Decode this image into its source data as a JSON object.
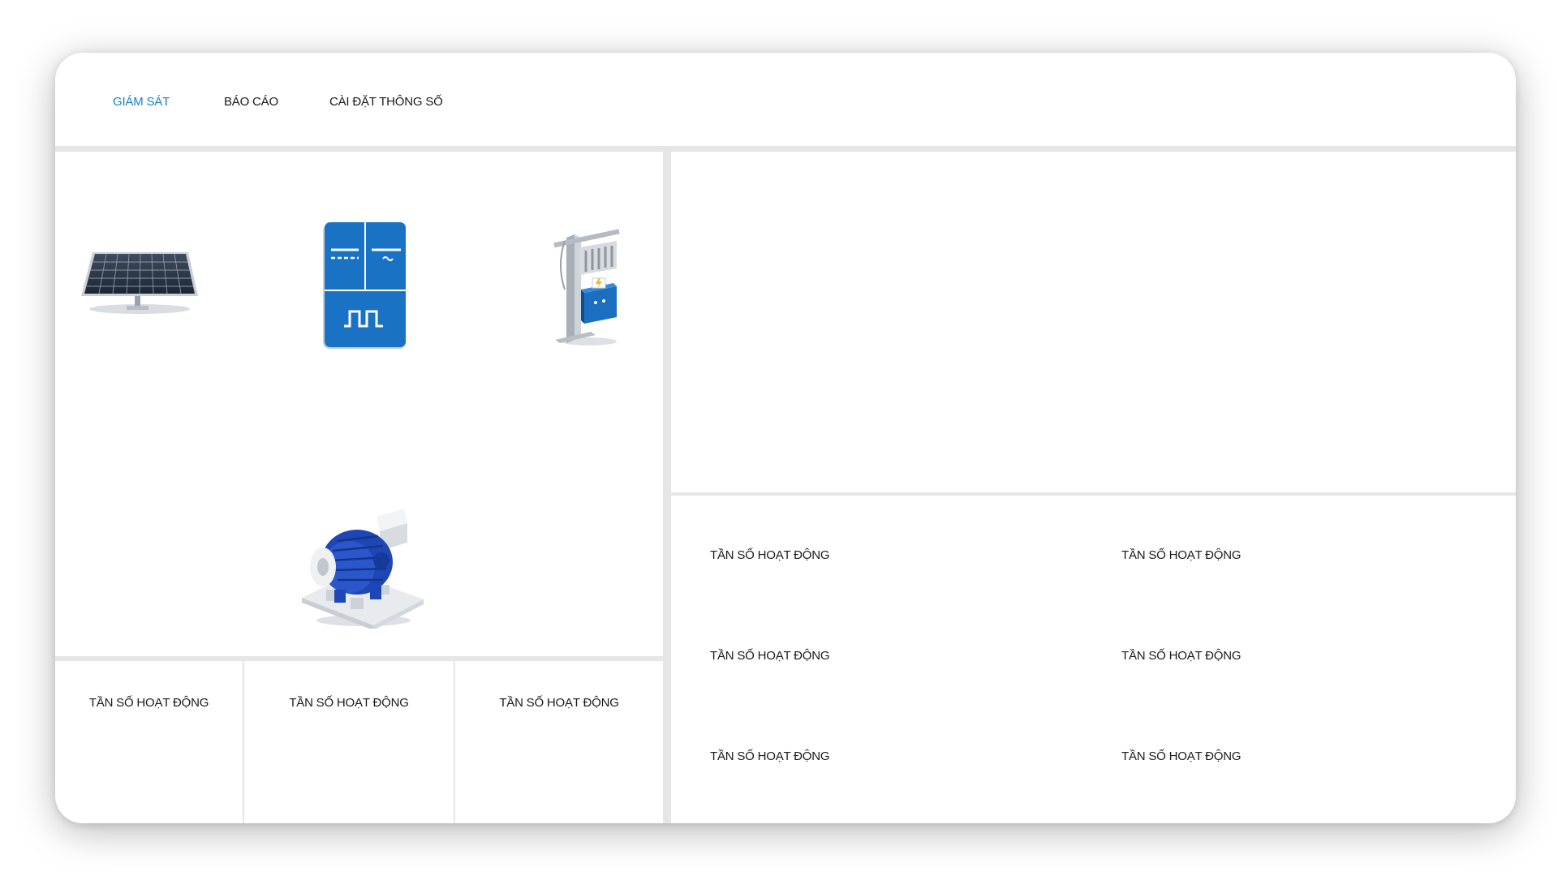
{
  "nav": {
    "tabs": [
      {
        "label": "GIÁM SÁT",
        "active": true
      },
      {
        "label": "BÁO CÁO",
        "active": false
      },
      {
        "label": "CÀI ĐẶT THÔNG SỐ",
        "active": false
      }
    ]
  },
  "diagram": {
    "devices": [
      {
        "name": "solar-panel",
        "icon": "solar-panel-icon"
      },
      {
        "name": "inverter",
        "icon": "inverter-icon"
      },
      {
        "name": "transformer-pole",
        "icon": "transformer-pole-icon"
      },
      {
        "name": "pump-motor",
        "icon": "motor-pump-icon"
      }
    ]
  },
  "bottom_stats": [
    {
      "label": "TẦN SỐ HOẠT ĐỘNG"
    },
    {
      "label": "TẦN SỐ HOẠT ĐỘNG"
    },
    {
      "label": "TẦN SỐ HOẠT ĐỘNG"
    }
  ],
  "right_stats": [
    {
      "label": "TẦN SỐ HOẠT ĐỘNG"
    },
    {
      "label": "TẦN SỐ HOẠT ĐỘNG"
    },
    {
      "label": "TẦN SỐ HOẠT ĐỘNG"
    },
    {
      "label": "TẦN SỐ HOẠT ĐỘNG"
    },
    {
      "label": "TẦN SỐ HOẠT ĐỘNG"
    },
    {
      "label": "TẦN SỐ HOẠT ĐỘNG"
    }
  ],
  "colors": {
    "accent": "#1581c6",
    "divider": "#e6e6e6",
    "text": "#1a1a1a"
  }
}
